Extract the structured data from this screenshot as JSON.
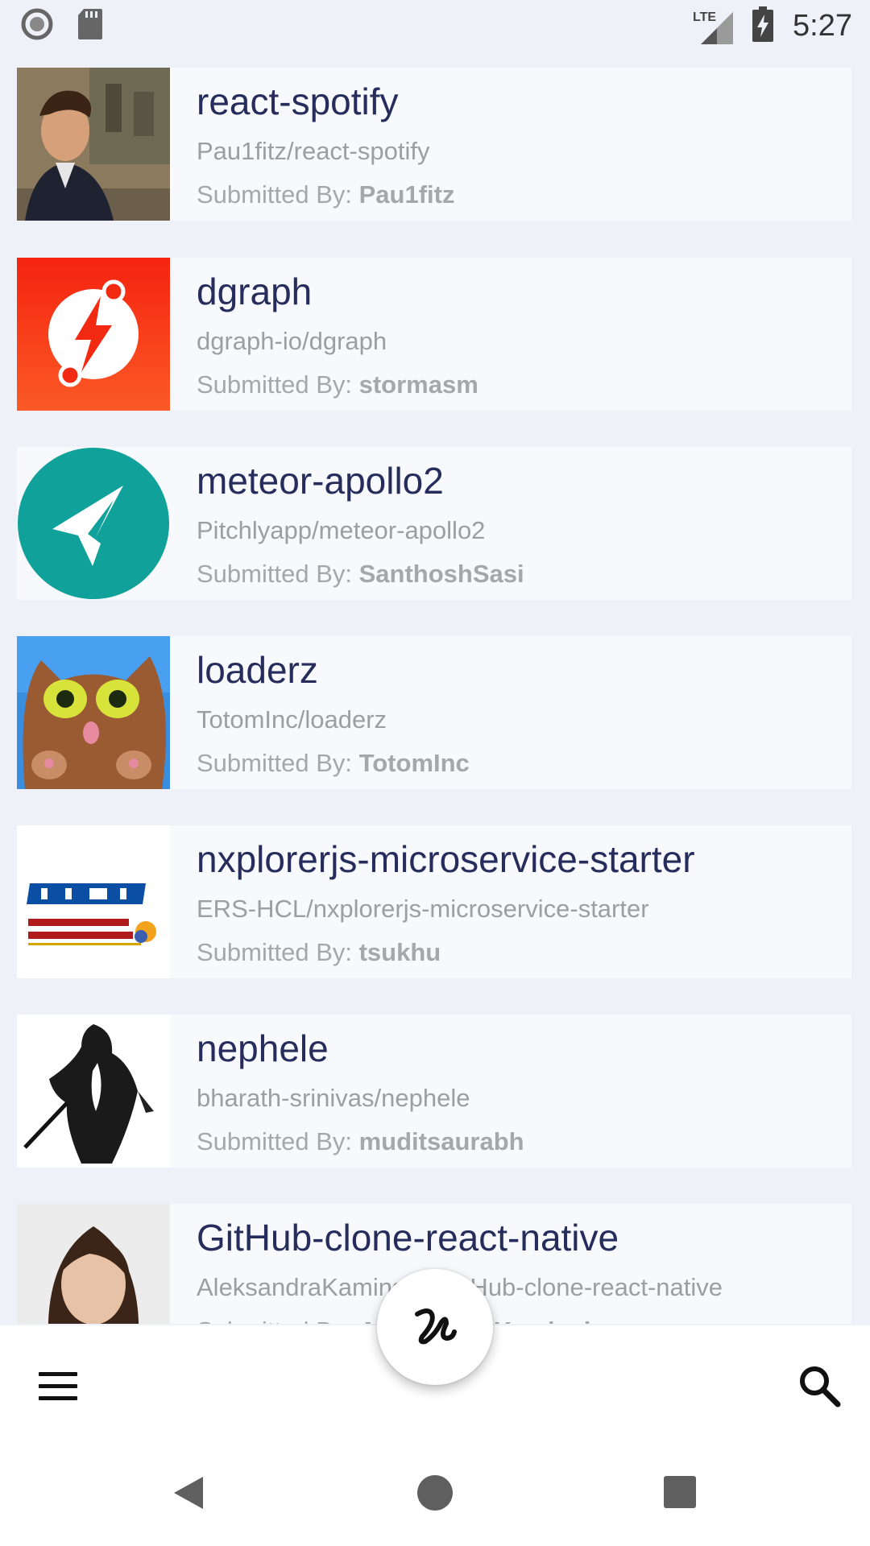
{
  "status_bar": {
    "time": "5:27",
    "network": "LTE",
    "left_icons": [
      "record-icon",
      "sd-card-icon"
    ],
    "right_icons": [
      "lte-signal-icon",
      "battery-charging-icon"
    ]
  },
  "feed": {
    "submitted_label": "Submitted By:",
    "items": [
      {
        "title": "react-spotify",
        "repo": "Pau1fitz/react-spotify",
        "submitter": "Pau1fitz",
        "thumb": "avatar-man-icon"
      },
      {
        "title": "dgraph",
        "repo": "dgraph-io/dgraph",
        "submitter": "stormasm",
        "thumb": "dgraph-logo-icon"
      },
      {
        "title": "meteor-apollo2",
        "repo": "Pitchlyapp/meteor-apollo2",
        "submitter": "SanthoshSasi",
        "thumb": "paper-plane-logo-icon"
      },
      {
        "title": "loaderz",
        "repo": "TotomInc/loaderz",
        "submitter": "TotomInc",
        "thumb": "cat-avatar-icon"
      },
      {
        "title": "nxplorerjs-microservice-starter",
        "repo": "ERS-HCL/nxplorerjs-microservice-starter",
        "submitter": "tsukhu",
        "thumb": "hcl-logo-icon"
      },
      {
        "title": "nephele",
        "repo": "bharath-srinivas/nephele",
        "submitter": "muditsaurabh",
        "thumb": "assassin-sketch-icon"
      },
      {
        "title": "GitHub-clone-react-native",
        "repo": "AleksandraKaminska/GitHub-clone-react-native",
        "submitter": "AleksandraKaminska",
        "thumb": "avatar-woman-icon"
      }
    ]
  },
  "app_bar": {
    "menu_icon": "hamburger-menu-icon",
    "fab_icon": "logo-squiggle-icon",
    "search_icon": "search-icon"
  },
  "nav_bar": {
    "icons": [
      "back-icon",
      "home-icon",
      "recents-icon"
    ]
  },
  "colors": {
    "background": "#eef1f8",
    "card": "#f7f9fc",
    "title": "#262d5c",
    "subtext": "#9b9ea3"
  }
}
